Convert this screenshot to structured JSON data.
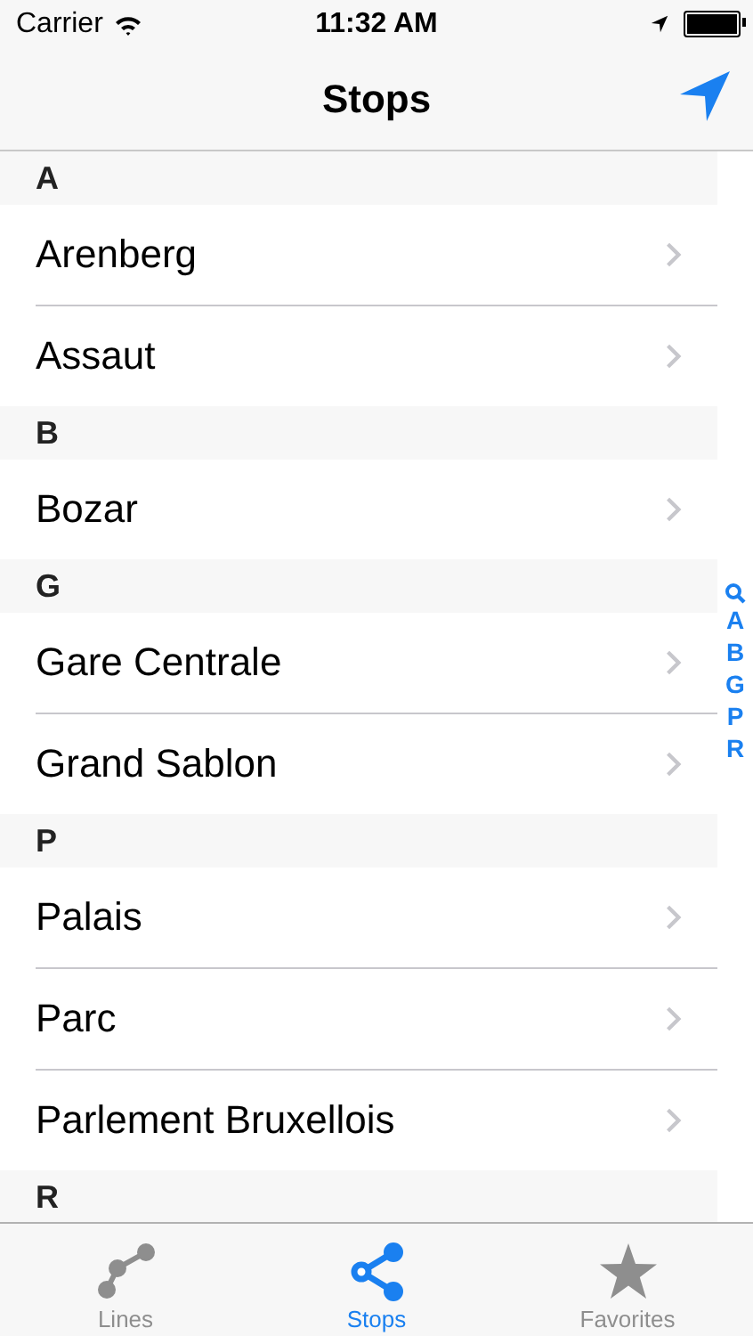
{
  "status_bar": {
    "carrier": "Carrier",
    "time": "11:32 AM"
  },
  "nav_bar": {
    "title": "Stops"
  },
  "sections": [
    {
      "letter": "A",
      "stops": [
        "Arenberg",
        "Assaut"
      ]
    },
    {
      "letter": "B",
      "stops": [
        "Bozar"
      ]
    },
    {
      "letter": "G",
      "stops": [
        "Gare Centrale",
        "Grand Sablon"
      ]
    },
    {
      "letter": "P",
      "stops": [
        "Palais",
        "Parc",
        "Parlement Bruxellois"
      ]
    },
    {
      "letter": "R"
    }
  ],
  "index": [
    "A",
    "B",
    "G",
    "P",
    "R"
  ],
  "tabs": [
    {
      "kind": "lines",
      "label": "Lines",
      "selected": false
    },
    {
      "kind": "stops",
      "label": "Stops",
      "selected": true
    },
    {
      "kind": "favorites",
      "label": "Favorites",
      "selected": false
    }
  ]
}
